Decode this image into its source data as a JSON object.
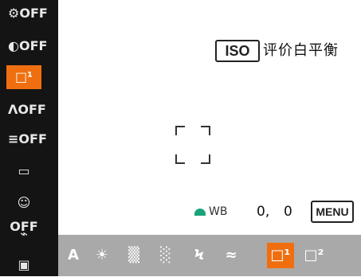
{
  "side_menu": {
    "items": [
      {
        "label": "⚙OFF",
        "icon": "i-contrast-off-icon"
      },
      {
        "label": "◐OFF",
        "icon": "highlight-tone-off-icon"
      },
      {
        "label": "□¹",
        "icon": "white-balance-custom1-icon",
        "selected": true
      },
      {
        "label": "ɅOFF",
        "icon": "af-off-icon"
      },
      {
        "label": "≡OFF",
        "icon": "nr-off-icon"
      },
      {
        "label": "▭",
        "icon": "aspect-ratio-icon"
      },
      {
        "label": "☺OFF",
        "icon": "face-off-icon"
      },
      {
        "label": "⌁",
        "icon": "flash-comp-icon"
      },
      {
        "label": "▣",
        "icon": "shooting-info-icon"
      }
    ]
  },
  "top_right": {
    "iso_label": "ISO",
    "wb_label": "评价白平衡"
  },
  "status": {
    "wb_shift": "WB",
    "exposure_a": "0,",
    "exposure_b": "0",
    "menu_label": "MENU"
  },
  "bottom_bar": {
    "items": [
      {
        "label": "A",
        "icon": "auto-wb-icon"
      },
      {
        "label": "☀",
        "icon": "daylight-icon"
      },
      {
        "label": "▒",
        "icon": "shade-icon"
      },
      {
        "label": "░",
        "icon": "cloudy-icon"
      },
      {
        "label": "Ϟ",
        "icon": "flash-icon"
      },
      {
        "label": "≈",
        "icon": "fluorescent-icon"
      },
      {
        "label": "□¹",
        "icon": "custom-wb1-icon",
        "selected": true
      },
      {
        "label": "□²",
        "icon": "custom-wb2-icon"
      }
    ]
  },
  "colors": {
    "selected": "#ef6f10",
    "bar": "#a9a9a9",
    "menu": "#141414"
  }
}
